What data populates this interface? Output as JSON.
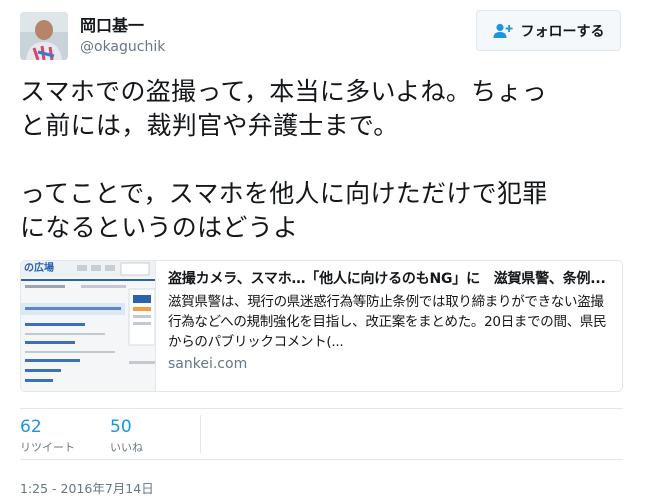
{
  "user": {
    "name": "岡口基一",
    "handle": "@okaguchik"
  },
  "follow_button": {
    "label": "フォローする"
  },
  "tweet": {
    "lines": [
      "スマホでの盗撮って，本当に多いよね。ちょっ",
      "と前には，裁判官や弁護士まで。",
      "",
      "ってことで，スマホを他人に向けただけで犯罪",
      "になるというのはどうよ"
    ]
  },
  "card": {
    "title": "盗撮カメラ、スマホ…「他人に向けるのもNG」に　滋賀県警、条例...",
    "description": "滋賀県警は、現行の県迷惑行為等防止条例では取り締まりができない盗撮行為などへの規制強化を目指し、改正案をまとめた。20日までの間、県民からのパブリックコメント(...",
    "domain": "sankei.com",
    "thumbnail": {
      "header_text": "の広場"
    }
  },
  "stats": {
    "retweets": {
      "count": "62",
      "label": "リツイート"
    },
    "likes": {
      "count": "50",
      "label": "いいね"
    }
  },
  "timestamp": "1:25 - 2016年7月14日",
  "colors": {
    "link_blue": "#1b95e0",
    "secondary_text": "#657786",
    "border": "#e1e8ed"
  }
}
